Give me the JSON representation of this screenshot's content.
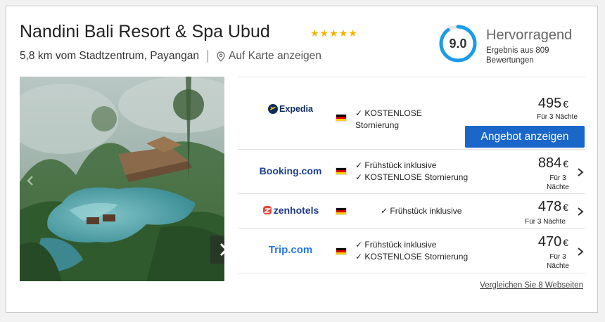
{
  "hotel": {
    "name": "Nandini Bali Resort & Spa Ubud",
    "stars": 5,
    "distance": "5,8 km vom Stadtzentrum, Payangan",
    "map_link": "Auf Karte anzeigen"
  },
  "rating": {
    "score": "9.0",
    "score_fraction": 0.9,
    "label": "Hervorragend",
    "subtext": "Ergebnis aus 809 Bewertungen",
    "ring_color": "#1b9ce6"
  },
  "offers": [
    {
      "provider": "Expedia",
      "features": [
        "KOSTENLOSE",
        "Stornierung"
      ],
      "price": "495",
      "currency": "€",
      "nights": "Für 3 Nächte",
      "button": "Angebot anzeigen"
    },
    {
      "provider": "Booking.com",
      "features": [
        "Frühstück inklusive",
        "KOSTENLOSE Stornierung"
      ],
      "price": "884",
      "currency": "€",
      "nights": "Für 3 Nächte"
    },
    {
      "provider": "zenhotels",
      "features": [
        "Frühstück inklusive"
      ],
      "price": "478",
      "currency": "€",
      "nights": "Für 3 Nächte"
    },
    {
      "provider": "Trip.com",
      "features": [
        "Frühstück inklusive",
        "KOSTENLOSE Stornierung"
      ],
      "price": "470",
      "currency": "€",
      "nights": "Für 3 Nächte"
    }
  ],
  "compare_link": "Vergleichen Sie 8 Webseiten",
  "colors": {
    "accent_button": "#1b66c9",
    "star": "#f5b400",
    "expedia": "#0d2c5e",
    "booking": "#1c3f95",
    "zenhotels": "#1f3a8a",
    "trip": "#2677e6"
  }
}
